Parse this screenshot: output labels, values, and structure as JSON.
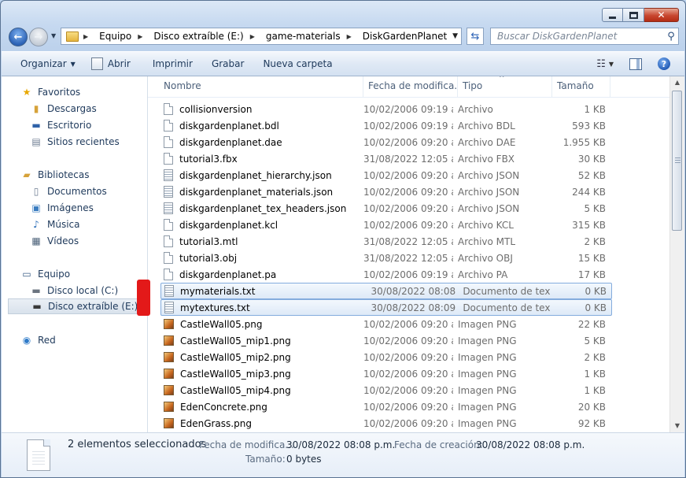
{
  "window": {
    "caption": {
      "minimize": "—",
      "maximize": "",
      "close": "✕"
    }
  },
  "address": {
    "crumbs": [
      "Equipo",
      "Disco extraíble (E:)",
      "game-materials",
      "DiskGardenPlanet"
    ],
    "search_placeholder": "Buscar DiskGardenPlanet"
  },
  "toolbar": {
    "organize": "Organizar",
    "open": "Abrir",
    "print": "Imprimir",
    "burn": "Grabar",
    "new_folder": "Nueva carpeta"
  },
  "nav": {
    "favorites": "Favoritos",
    "downloads": "Descargas",
    "desktop": "Escritorio",
    "recent": "Sitios recientes",
    "libraries": "Bibliotecas",
    "documents": "Documentos",
    "images": "Imágenes",
    "music": "Música",
    "videos": "Vídeos",
    "computer": "Equipo",
    "local_disk": "Disco local (C:)",
    "removable": "Disco extraíble (E:)",
    "network": "Red"
  },
  "columns": {
    "name": "Nombre",
    "date": "Fecha de modifica...",
    "type": "Tipo",
    "size": "Tamaño"
  },
  "files": [
    {
      "name": "collisionversion",
      "date": "10/02/2006 09:19 a...",
      "type": "Archivo",
      "size": "1 KB",
      "icon": "doc"
    },
    {
      "name": "diskgardenplanet.bdl",
      "date": "10/02/2006 09:19 a...",
      "type": "Archivo BDL",
      "size": "593 KB",
      "icon": "doc"
    },
    {
      "name": "diskgardenplanet.dae",
      "date": "10/02/2006 09:20 a...",
      "type": "Archivo DAE",
      "size": "1.955 KB",
      "icon": "doc"
    },
    {
      "name": "tutorial3.fbx",
      "date": "31/08/2022 12:05 a...",
      "type": "Archivo FBX",
      "size": "30 KB",
      "icon": "doc"
    },
    {
      "name": "diskgardenplanet_hierarchy.json",
      "date": "10/02/2006 09:20 a...",
      "type": "Archivo JSON",
      "size": "52 KB",
      "icon": "json"
    },
    {
      "name": "diskgardenplanet_materials.json",
      "date": "10/02/2006 09:20 a...",
      "type": "Archivo JSON",
      "size": "244 KB",
      "icon": "json"
    },
    {
      "name": "diskgardenplanet_tex_headers.json",
      "date": "10/02/2006 09:20 a...",
      "type": "Archivo JSON",
      "size": "5 KB",
      "icon": "json"
    },
    {
      "name": "diskgardenplanet.kcl",
      "date": "10/02/2006 09:20 a...",
      "type": "Archivo KCL",
      "size": "315 KB",
      "icon": "doc"
    },
    {
      "name": "tutorial3.mtl",
      "date": "31/08/2022 12:05 a...",
      "type": "Archivo MTL",
      "size": "2 KB",
      "icon": "doc"
    },
    {
      "name": "tutorial3.obj",
      "date": "31/08/2022 12:05 a...",
      "type": "Archivo OBJ",
      "size": "15 KB",
      "icon": "doc"
    },
    {
      "name": "diskgardenplanet.pa",
      "date": "10/02/2006 09:19 a...",
      "type": "Archivo PA",
      "size": "17 KB",
      "icon": "doc"
    },
    {
      "name": "mymaterials.txt",
      "date": "30/08/2022 08:08 ...",
      "type": "Documento de tex...",
      "size": "0 KB",
      "icon": "json",
      "selected": true
    },
    {
      "name": "mytextures.txt",
      "date": "30/08/2022 08:09 ...",
      "type": "Documento de tex...",
      "size": "0 KB",
      "icon": "json",
      "selected": true
    },
    {
      "name": "CastleWall05.png",
      "date": "10/02/2006 09:20 a...",
      "type": "Imagen PNG",
      "size": "22 KB",
      "icon": "png"
    },
    {
      "name": "CastleWall05_mip1.png",
      "date": "10/02/2006 09:20 a...",
      "type": "Imagen PNG",
      "size": "5 KB",
      "icon": "png"
    },
    {
      "name": "CastleWall05_mip2.png",
      "date": "10/02/2006 09:20 a...",
      "type": "Imagen PNG",
      "size": "2 KB",
      "icon": "png"
    },
    {
      "name": "CastleWall05_mip3.png",
      "date": "10/02/2006 09:20 a...",
      "type": "Imagen PNG",
      "size": "1 KB",
      "icon": "png"
    },
    {
      "name": "CastleWall05_mip4.png",
      "date": "10/02/2006 09:20 a...",
      "type": "Imagen PNG",
      "size": "1 KB",
      "icon": "png"
    },
    {
      "name": "EdenConcrete.png",
      "date": "10/02/2006 09:20 a...",
      "type": "Imagen PNG",
      "size": "20 KB",
      "icon": "png"
    },
    {
      "name": "EdenGrass.png",
      "date": "10/02/2006 09:20 a...",
      "type": "Imagen PNG",
      "size": "92 KB",
      "icon": "png"
    }
  ],
  "details": {
    "summary": "2 elementos seleccionados",
    "modified_label": "Fecha de modifica...",
    "modified_value": "30/08/2022 08:08 p.m.",
    "created_label": "Fecha de creación:",
    "created_value": "30/08/2022 08:08 p.m.",
    "size_label": "Tamaño:",
    "size_value": "0 bytes"
  },
  "colors": {
    "selection_border": "#84acdd",
    "annotation_mark": "#e31919"
  }
}
